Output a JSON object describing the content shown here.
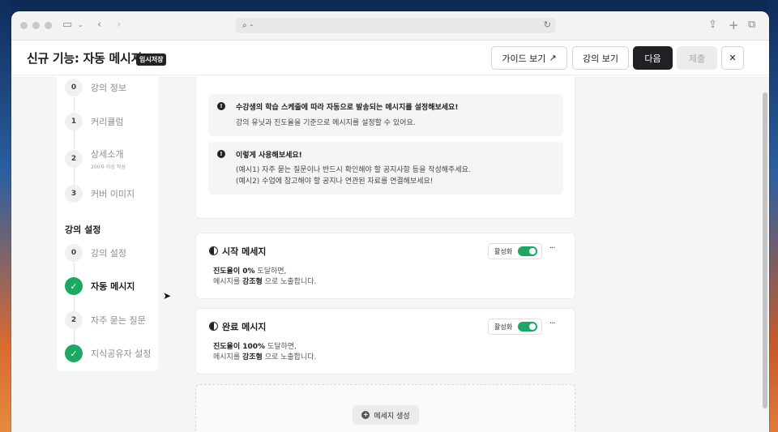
{
  "browser": {
    "url": "-"
  },
  "header": {
    "title": "신규 기능: 자동 메시지",
    "draft_badge": "임시저장",
    "guide_button": "가이드 보기",
    "preview_button": "강의 보기",
    "next_button": "다음",
    "submit_button": "제출",
    "close_icon": "✕"
  },
  "sidebar": {
    "steps_top": [
      {
        "num": "0",
        "label": "강의 정보"
      },
      {
        "num": "1",
        "label": "커리큘럼"
      },
      {
        "num": "2",
        "label": "상세소개",
        "sub": "200자 이상 작성"
      },
      {
        "num": "3",
        "label": "커버 이미지"
      }
    ],
    "section_title": "강의 설정",
    "steps_bottom": [
      {
        "num": "0",
        "label": "강의 설정"
      },
      {
        "num": "✓",
        "label": "자동 메시지"
      },
      {
        "num": "2",
        "label": "자주 묻는 질문"
      },
      {
        "num": "✓",
        "label": "지식공유자 설정"
      }
    ]
  },
  "notices": [
    {
      "title": "수강생의 학습 스케줄에 따라 자동으로 발송되는 메시지를 설정해보세요!",
      "lines": [
        "강의 유닛과 진도율을 기준으로 메시지를 설정할 수 있어요."
      ]
    },
    {
      "title": "이렇게 사용해보세요!",
      "lines": [
        "(예시1) 자주 묻는 질문이나 반드시 확인해야 할 공지사항 등을 작성해주세요.",
        "(예시2) 수업에 참고해야 할 공지나 연관된 자료를 연결해보세요!"
      ]
    }
  ],
  "messages": [
    {
      "title": "시작 메세지",
      "toggle_label": "활성화",
      "progress_label": "진도율이 0%",
      "progress_suffix": " 도달하면,",
      "line2_prefix": "메시지를 ",
      "line2_bold": "강조형",
      "line2_suffix": " 으로 노출합니다."
    },
    {
      "title": "완료 메시지",
      "toggle_label": "활성화",
      "progress_label": "진도율이 100%",
      "progress_suffix": " 도달하면,",
      "line2_prefix": "메시지를 ",
      "line2_bold": "강조형",
      "line2_suffix": " 으로 노출합니다."
    }
  ],
  "create_button": "메세지 생성",
  "colors": {
    "accent_green": "#1aa863",
    "dark_button": "#1f2124"
  }
}
